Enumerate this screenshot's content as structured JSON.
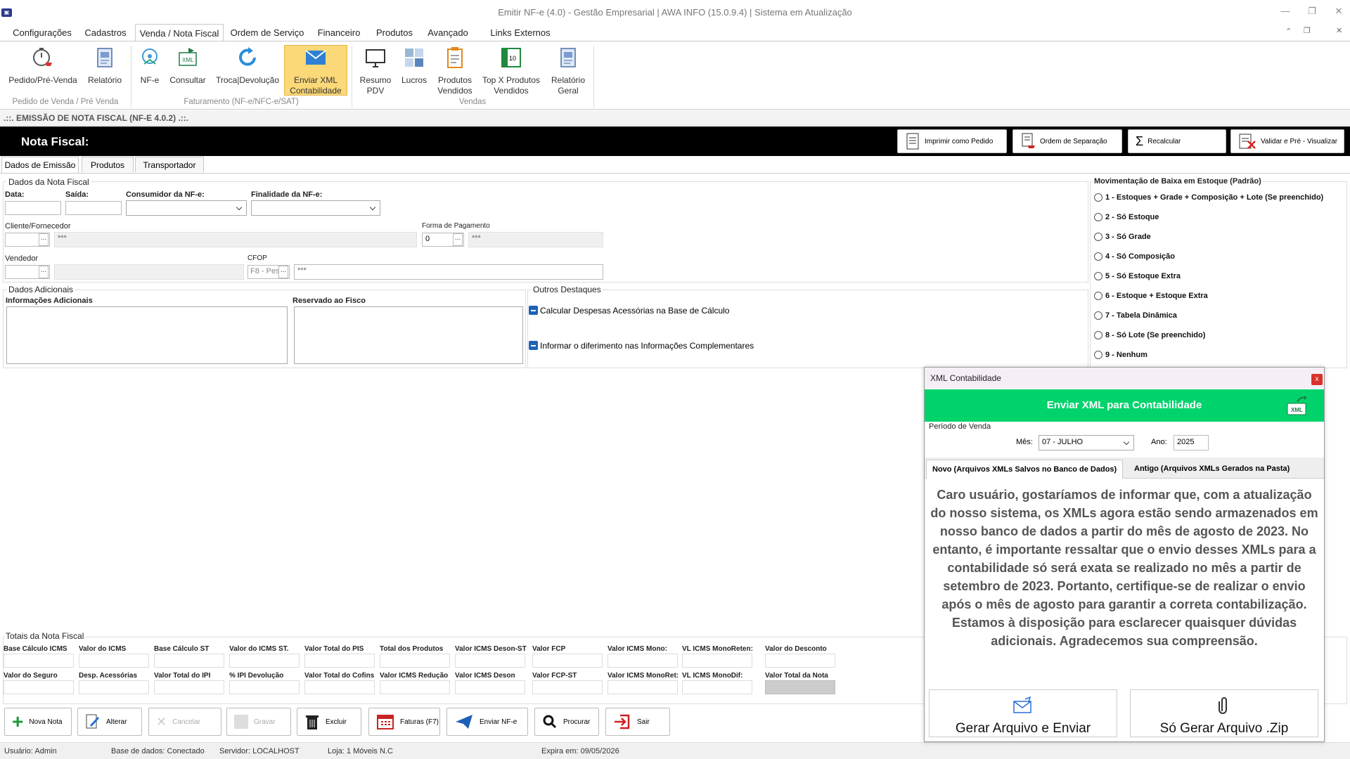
{
  "window": {
    "title": "Emitir NF-e (4.0) - Gestão Empresarial | AWA INFO (15.0.9.4) | Sistema em Atualização"
  },
  "menu": [
    "Configurações",
    "Cadastros",
    "Venda / Nota Fiscal",
    "Ordem de Serviço",
    "Financeiro",
    "Produtos",
    "Avançado",
    "Links Externos"
  ],
  "ribbon": {
    "buttons": [
      {
        "l1": "Pedido/Pré-Venda",
        "l2": ""
      },
      {
        "l1": "Relatório",
        "l2": ""
      },
      {
        "l1": "NF-e",
        "l2": ""
      },
      {
        "l1": "Consultar",
        "l2": ""
      },
      {
        "l1": "Troca|Devolução",
        "l2": ""
      },
      {
        "l1": "Enviar XML",
        "l2": "Contabilidade"
      },
      {
        "l1": "Resumo",
        "l2": "PDV"
      },
      {
        "l1": "Lucros",
        "l2": ""
      },
      {
        "l1": "Produtos",
        "l2": "Vendidos"
      },
      {
        "l1": "Top X Produtos",
        "l2": "Vendidos"
      },
      {
        "l1": "Relatório",
        "l2": "Geral"
      }
    ],
    "groups": [
      "Pedido de Venda / Pré Venda",
      "Faturamento (NF-e/NFC-e/SAT)",
      "Vendas"
    ]
  },
  "section_title": ".::. EMISSÃO DE NOTA FISCAL (NF-E 4.0.2) .::.",
  "header": {
    "title": "Nota Fiscal:",
    "buttons": [
      "Imprimir como Pedido",
      "Ordem de Separação",
      "Recalcular",
      "Validar e Pré - Visualizar"
    ]
  },
  "tabs": [
    "Dados de Emissão",
    "Produtos",
    "Transportador"
  ],
  "dados_nf": {
    "group": "Dados da Nota Fiscal",
    "data": "Data:",
    "saida": "Saída:",
    "consumidor": "Consumidor da NF-e:",
    "finalidade": "Finalidade da NF-e:",
    "cliente": "Cliente/Fornecedor",
    "cliente_name": "***",
    "forma_pag": "Forma de Pagamento",
    "forma_pag_code": "0",
    "forma_pag_name": "***",
    "vendedor": "Vendedor",
    "cfop": "CFOP",
    "cfop_value": "F8 - Pes",
    "cfop_name": "***"
  },
  "adicionais": {
    "group": "Dados Adicionais",
    "info": "Informações Adicionais",
    "fisco": "Reservado ao Fisco"
  },
  "destaques": {
    "group": "Outros Destaques",
    "opt1": "Calcular Despesas Acessórias na Base de Cálculo",
    "opt2": "Informar o diferimento nas Informações Complementares"
  },
  "estoque": {
    "group": "Movimentação de Baixa em Estoque (Padrão)",
    "options": [
      "1 - Estoques + Grade + Composição + Lote (Se preenchido)",
      "2 - Só Estoque",
      "3 - Só Grade",
      "4 - Só Composição",
      "5 - Só Estoque Extra",
      "6 - Estoque + Estoque Extra",
      "7 - Tabela Dinâmica",
      "8 - Só Lote (Se preenchido)",
      "9 - Nenhum"
    ]
  },
  "totais": {
    "group": "Totais da Nota Fiscal",
    "row1": [
      "Base Cálculo ICMS",
      "Valor do ICMS",
      "Base Cálculo ST",
      "Valor do ICMS ST.",
      "Valor Total do PIS",
      "Total dos Produtos",
      "Valor ICMS Deson-ST",
      "Valor FCP",
      "Valor ICMS Mono:",
      "VL ICMS MonoReten:",
      "Valor do Desconto"
    ],
    "row2": [
      "Valor do Seguro",
      "Desp. Acessórias",
      "Valor Total do IPI",
      "% IPI Devolução",
      "Valor Total do Cofins",
      "Valor ICMS Redução",
      "Valor ICMS Deson",
      "Valor FCP-ST",
      "Valor ICMS MonoRet:",
      "VL ICMS MonoDif:",
      "Valor Total da Nota"
    ]
  },
  "actions": [
    "Nova Nota",
    "Alterar",
    "Cancelar",
    "Gravar",
    "Excluir",
    "Faturas (F7)",
    "Enviar NF-e",
    "Procurar",
    "Sair"
  ],
  "status": {
    "usuario": "Usuário: Admin",
    "base": "Base de dados: Conectado",
    "servidor": "Servidor: LOCALHOST",
    "loja": "Loja:  1  Móveis N.C",
    "expira": "Expira em: 09/05/2026"
  },
  "modal": {
    "title": "XML Contabilidade",
    "close": "x",
    "banner": "Enviar XML para Contabilidade",
    "periodo": "Período de Venda",
    "mes_label": "Mês:",
    "mes_value": "07 - JULHO",
    "ano_label": "Ano:",
    "ano_value": "2025",
    "tab_new": "Novo (Arquivos XMLs Salvos no Banco de Dados)",
    "tab_old": "Antigo (Arquivos XMLs Gerados na Pasta)",
    "message": "Caro usuário, gostaríamos de informar que, com a atualização do nosso sistema, os XMLs agora estão sendo armazenados em nosso banco de dados a partir do mês de agosto de 2023. No entanto, é importante ressaltar que o envio desses XMLs para a contabilidade só será exata se realizado no mês a partir de setembro de 2023. Portanto, certifique-se de realizar o envio após o mês de agosto para garantir a correta contabilização. Estamos à disposição para esclarecer quaisquer dúvidas adicionais. Agradecemos sua compreensão.",
    "btn_send": "Gerar Arquivo e Enviar",
    "btn_zip": "Só Gerar Arquivo .Zip"
  }
}
